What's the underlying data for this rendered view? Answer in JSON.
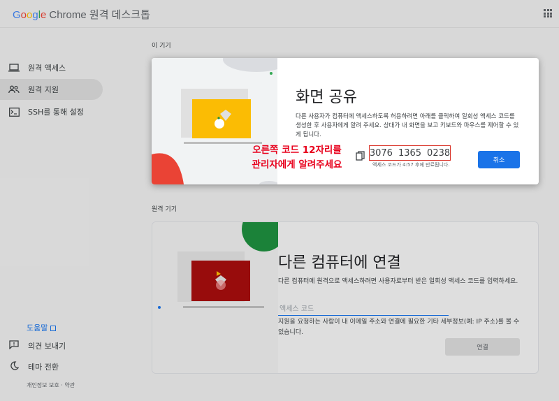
{
  "app": {
    "logo_google_letters": [
      "G",
      "o",
      "o",
      "g",
      "l",
      "e"
    ],
    "logo_rest": "Chrome 원격 데스크톱"
  },
  "sidebar": {
    "items": [
      {
        "label": "원격 액세스",
        "icon": "laptop-icon",
        "active": false
      },
      {
        "label": "원격 지원",
        "icon": "people-icon",
        "active": true
      },
      {
        "label": "SSH를 통해 설정",
        "icon": "terminal-icon",
        "active": false
      }
    ],
    "help_label": "도움말",
    "feedback_label": "의견 보내기",
    "theme_label": "테마 전환",
    "legal": "개인정보 보호 · 약관"
  },
  "sections": {
    "this_device": "이 기기",
    "remote_device": "원격 기기"
  },
  "share_dialog": {
    "title": "화면 공유",
    "description": "다른 사용자가 컴퓨터에 액세스하도록 허용하려면 아래를 클릭하여 일회성 액세스 코드를 생성한 후 사용자에게 알려 주세요. 상대가 내 화면을 보고 키보드와 마우스를 제어할 수 있게 됩니다.",
    "code_groups": [
      "3076",
      "1365",
      "0238"
    ],
    "expire_text": "액세스 코드가 4:57 후에 만료됩니다.",
    "cancel_label": "취소"
  },
  "annotation": {
    "line1": "오른쪽 코드 12자리를",
    "line2": "관리자에게 알려주세요",
    "color": "#e8001c"
  },
  "connect_card": {
    "title": "다른 컴퓨터에 연결",
    "description": "다른 컴퓨터에 원격으로 액세스하려면 사용자로부터 받은 일회성 액세스 코드를 입력하세요.",
    "input_placeholder": "액세스 코드",
    "helper_text": "지원을 요청하는 사람이 내 이메일 주소와 연결에 필요한 기타 세부정보(예: IP 주소)를 볼 수 있습니다.",
    "connect_label": "연결"
  },
  "colors": {
    "accent": "#1a73e8",
    "annotation_red": "#e8001c",
    "illustration_yellow": "#fbbc04",
    "illustration_red": "#c5221f"
  }
}
